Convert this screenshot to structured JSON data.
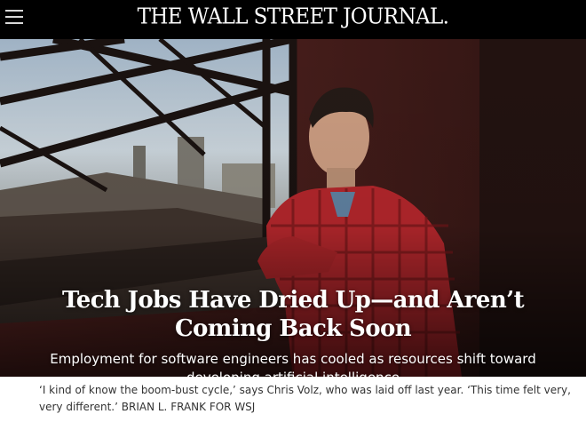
{
  "header": {
    "masthead": "THE WALL STREET JOURNAL."
  },
  "article": {
    "headline": "Tech Jobs Have Dried Up—and Aren’t Coming Back Soon",
    "dek": "Employment for software engineers has cooled as resources shift toward developing artificial intelligence",
    "caption": "‘I kind of know the boom-bust cycle,’ says Chris Volz, who was laid off last year. ‘This time felt very, very different.’",
    "credit": "BRIAN L. FRANK FOR WSJ"
  },
  "icons": {
    "menu": "hamburger-menu-icon"
  },
  "colors": {
    "topbar": "#000000",
    "shirt": "#b0262b",
    "wall": "#4a1f1c",
    "caption_text": "#333333"
  }
}
